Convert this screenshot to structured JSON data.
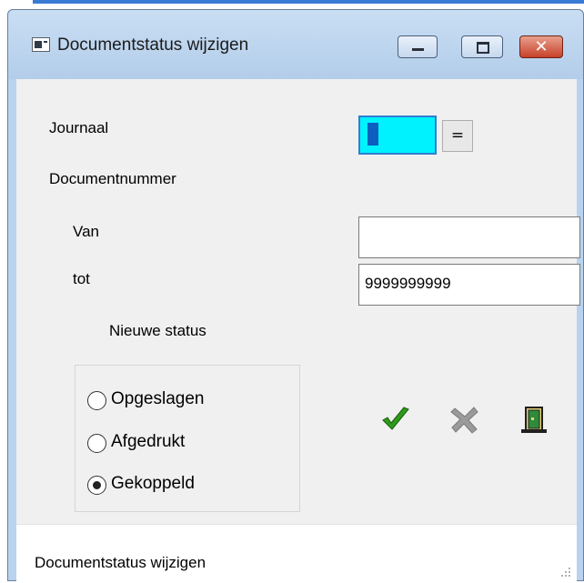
{
  "window": {
    "title": "Documentstatus wijzigen",
    "close_glyph": "✕"
  },
  "form": {
    "journal_label": "Journaal",
    "journal_value": "",
    "equals_button_label": "=",
    "document_number_label": "Documentnummer",
    "from_label": "Van",
    "from_value": "",
    "to_label": "tot",
    "to_value": "9999999999",
    "new_status_label": "Nieuwe status"
  },
  "status_options": [
    {
      "label": "Opgeslagen",
      "selected": false
    },
    {
      "label": "Afgedrukt",
      "selected": false
    },
    {
      "label": "Gekoppeld",
      "selected": true
    }
  ],
  "actions": {
    "confirm_icon": "check-icon",
    "cancel_icon": "cross-icon",
    "exit_icon": "exit-door-icon"
  },
  "statusbar": {
    "text": "Documentstatus wijzigen"
  },
  "colors": {
    "journal_highlight": "#00f2ff",
    "titlebar": "#b9d3ee",
    "close_button": "#c8412a",
    "confirm_green": "#2e9a1b",
    "cancel_gray": "#9a9a9a"
  }
}
